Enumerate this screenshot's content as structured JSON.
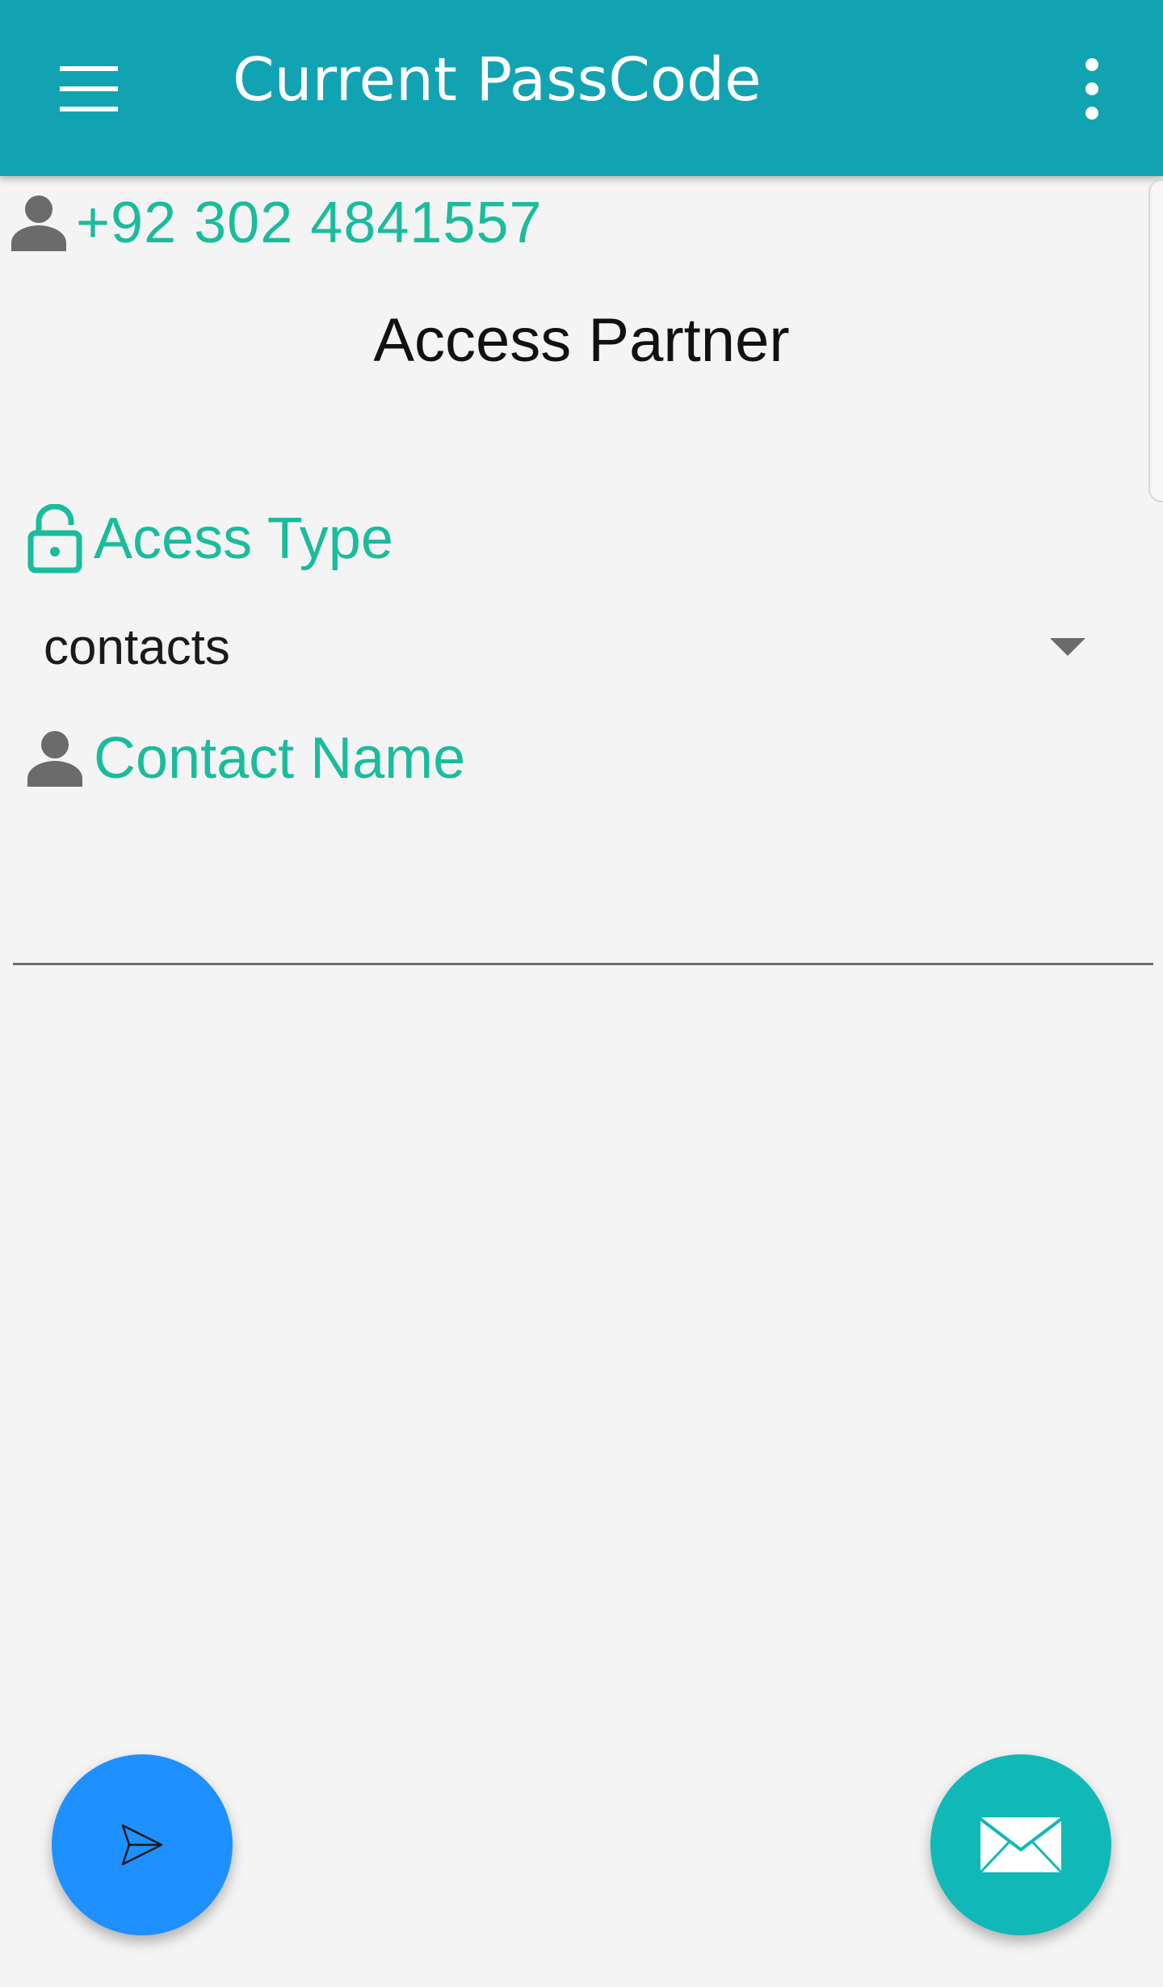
{
  "app_bar": {
    "title": "Current PassCode",
    "background_color": "#12a3b2",
    "menu_icon": "hamburger-menu-icon",
    "overflow_icon": "more-vert-icon"
  },
  "user": {
    "icon": "person-icon",
    "phone": "+92 302 4841557"
  },
  "section": {
    "title": "Access Partner"
  },
  "access_type": {
    "icon": "lock-open-icon",
    "label": "Acess Type",
    "selected_value": "contacts"
  },
  "contact_name": {
    "icon": "person-icon",
    "label": "Contact Name",
    "value": ""
  },
  "fabs": {
    "send": {
      "icon": "send-icon",
      "color": "#1e90ff"
    },
    "mail": {
      "icon": "mail-icon",
      "color": "#10b9b8"
    }
  },
  "colors": {
    "accent": "#1abc9c",
    "background": "#f4f4f4"
  }
}
